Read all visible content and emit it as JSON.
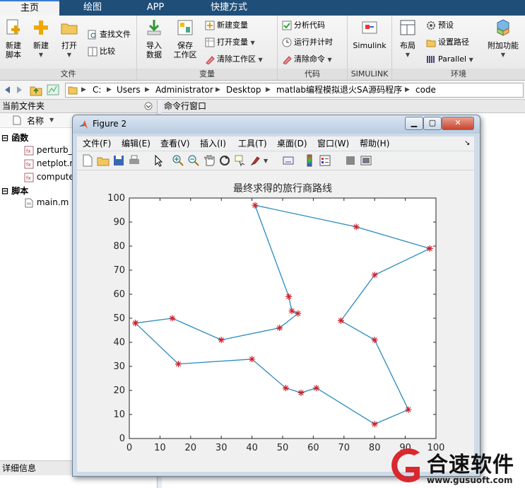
{
  "tabs": [
    {
      "label": "主页",
      "active": true
    },
    {
      "label": "绘图",
      "active": false
    },
    {
      "label": "APP",
      "active": false
    },
    {
      "label": "快捷方式",
      "active": false
    }
  ],
  "ribbon": {
    "file_group": {
      "title": "文件",
      "new_script": "新建\n脚本",
      "new": "新建",
      "open": "打开",
      "find_files": "查找文件",
      "compare": "比较"
    },
    "variable_group": {
      "title": "变量",
      "import_data": "导入\n数据",
      "save_workspace": "保存\n工作区",
      "new_variable": "新建变量",
      "open_variable": "打开变量",
      "clear_workspace": "清除工作区"
    },
    "code_group": {
      "title": "代码",
      "analyze_code": "分析代码",
      "run_and_time": "运行并计时",
      "clear_commands": "清除命令"
    },
    "simulink_group": {
      "title": "SIMULINK",
      "simulink": "Simulink"
    },
    "env_group": {
      "title": "环境",
      "layout": "布局",
      "preferences": "预设",
      "set_path": "设置路径",
      "parallel": "Parallel",
      "addons": "附加功能"
    }
  },
  "address": {
    "segments": [
      "C:",
      "Users",
      "Administrator",
      "Desktop",
      "matlab编程模拟退火SA源码程序",
      "code"
    ]
  },
  "left_panel": {
    "title": "当前文件夹",
    "col_name": "名称",
    "functions_label": "函数",
    "scripts_label": "脚本",
    "files": [
      "perturb_",
      "netplot.r",
      "compute"
    ],
    "script_files": [
      "main.m"
    ],
    "details": "详细信息"
  },
  "command_panel": {
    "title": "命令行窗口"
  },
  "figure": {
    "title": "Figure 2",
    "menus": [
      "文件(F)",
      "编辑(E)",
      "查看(V)",
      "插入(I)",
      "工具(T)",
      "桌面(D)",
      "窗口(W)",
      "帮助(H)"
    ],
    "toolbar_icons": [
      "new-figure-icon",
      "open-file-icon",
      "save-icon",
      "print-icon",
      "select-arrow-icon",
      "zoom-in-icon",
      "zoom-out-icon",
      "pan-hand-icon",
      "rotate-3d-icon",
      "data-cursor-icon",
      "brush-icon",
      "link-plot-icon",
      "colorbar-icon",
      "legend-icon",
      "hide-plot-tools-icon",
      "show-plot-tools-icon"
    ]
  },
  "watermark": {
    "brand": "合速软件",
    "url": "www.gusuoft.com"
  },
  "colors": {
    "line": "#2a8abf",
    "marker": "#d0202a",
    "accent_tab": "#1f4e79"
  },
  "chart_data": {
    "type": "line",
    "title": "最终求得的旅行商路线",
    "xlabel": "",
    "ylabel": "",
    "xlim": [
      0,
      100
    ],
    "ylim": [
      0,
      100
    ],
    "xticks": [
      0,
      10,
      20,
      30,
      40,
      50,
      60,
      70,
      80,
      90,
      100
    ],
    "yticks": [
      0,
      10,
      20,
      30,
      40,
      50,
      60,
      70,
      80,
      90,
      100
    ],
    "grid": false,
    "marker": "*",
    "route_x": [
      2,
      14,
      30,
      49,
      55,
      53,
      52,
      41,
      74,
      98,
      80,
      69,
      80,
      91,
      80,
      61,
      56,
      51,
      40,
      16,
      2
    ],
    "route_y": [
      48,
      50,
      41,
      46,
      52,
      53,
      59,
      97,
      88,
      79,
      68,
      49,
      41,
      12,
      6,
      21,
      19,
      21,
      33,
      31,
      48
    ]
  }
}
